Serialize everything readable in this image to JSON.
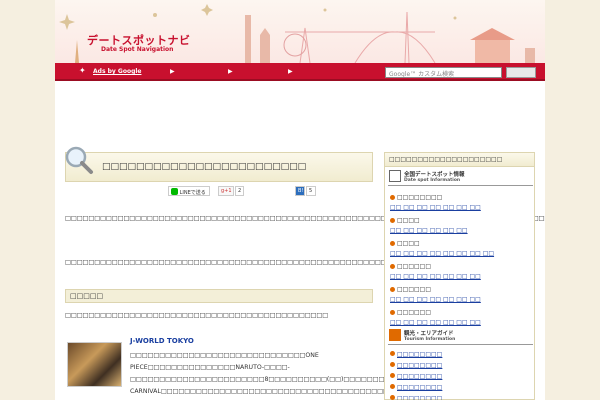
{
  "header": {
    "title": "デートスポットナビ",
    "subtitle": "Date Spot Navigation"
  },
  "nav": {
    "ads_label": "Ads by Google",
    "arrow1": "▶",
    "arrow2": "▶",
    "arrow3": "▶",
    "search_placeholder": "Google™ カスタム検索"
  },
  "article": {
    "title": "□□□□□□□□□□□□□□□□□□□□□□□□",
    "share_line": "LINEで送る",
    "share_gplus": "g+1",
    "share_gplus_count": "2",
    "share_b_count": "5",
    "para1": "□□□□□□□□□□□□□□□□□□□□□□□□□□□□□□□□□□□□□□□□□□□□□□□□□□□□□□□□□□□□□□□□□□□□□□□□□□□□□□□□□□□□□□□□□□□□□□□□□□□□□□□□□□□□□□□□□□□□□□□□□□□□!!",
    "para2": "□□□□□□□□□□□□□□□□□□□□□□□□□□□□□□□□□□□□□□□□□□□□□□□□□□□□□□□□□□□□□□□□□□□□□□□□□□□□□□□□",
    "section_title": "□□□□□",
    "para3": "□□□□□□□□□□□□□□□□□□□□□□□□□□□□□□□□□□□□□□□□□□□□□",
    "item_title": "J-WORLD TOKYO",
    "item_desc": "□□□□□□□□□□□□□□□□□□□□□□□□□□□□□□ONE PIECE□□□□□□□□□□□□□□□NARUTO-□□□□-□□□□□□□□□□□□□□□□□□□□□□□8□□□□□□□□□□(□□)□□□□□□□-CARNIVAL□□□□□□□□□□□□□□□□□□□□□□□□□□□□□□□□□□□□□□□□□□□□□□□□□□□□□□□□□□□□□"
  },
  "sidebar": {
    "heading": "□□□□□□□□□□□□□□□□□□□□",
    "banner1_title": "全国デートスポット情報",
    "banner1_sub": "Date spot Information",
    "cats": [
      {
        "label": "□□□□□□□□",
        "links": "□□ □□ □□ □□ □□ □□ □□"
      },
      {
        "label": "□□□□",
        "links": "□□ □□ □□ □□ □□ □□"
      },
      {
        "label": "□□□□",
        "links": "□□ □□ □□ □□ □□ □□ □□ □□"
      },
      {
        "label": "□□□□□□",
        "links": "□□ □□ □□ □□ □□ □□ □□"
      },
      {
        "label": "□□□□□□",
        "links": "□□ □□ □□ □□ □□ □□ □□"
      },
      {
        "label": "□□□□□□",
        "links": "□□ □□ □□ □□ □□ □□ □□"
      }
    ],
    "banner2_title": "観光・エリアガイド",
    "banner2_sub": "Tourism Information",
    "guide_links": [
      "□□□□□□□□",
      "□□□□□□□□",
      "□□□□□□□□",
      "□□□□□□□□",
      "□□□□□□□□"
    ]
  }
}
